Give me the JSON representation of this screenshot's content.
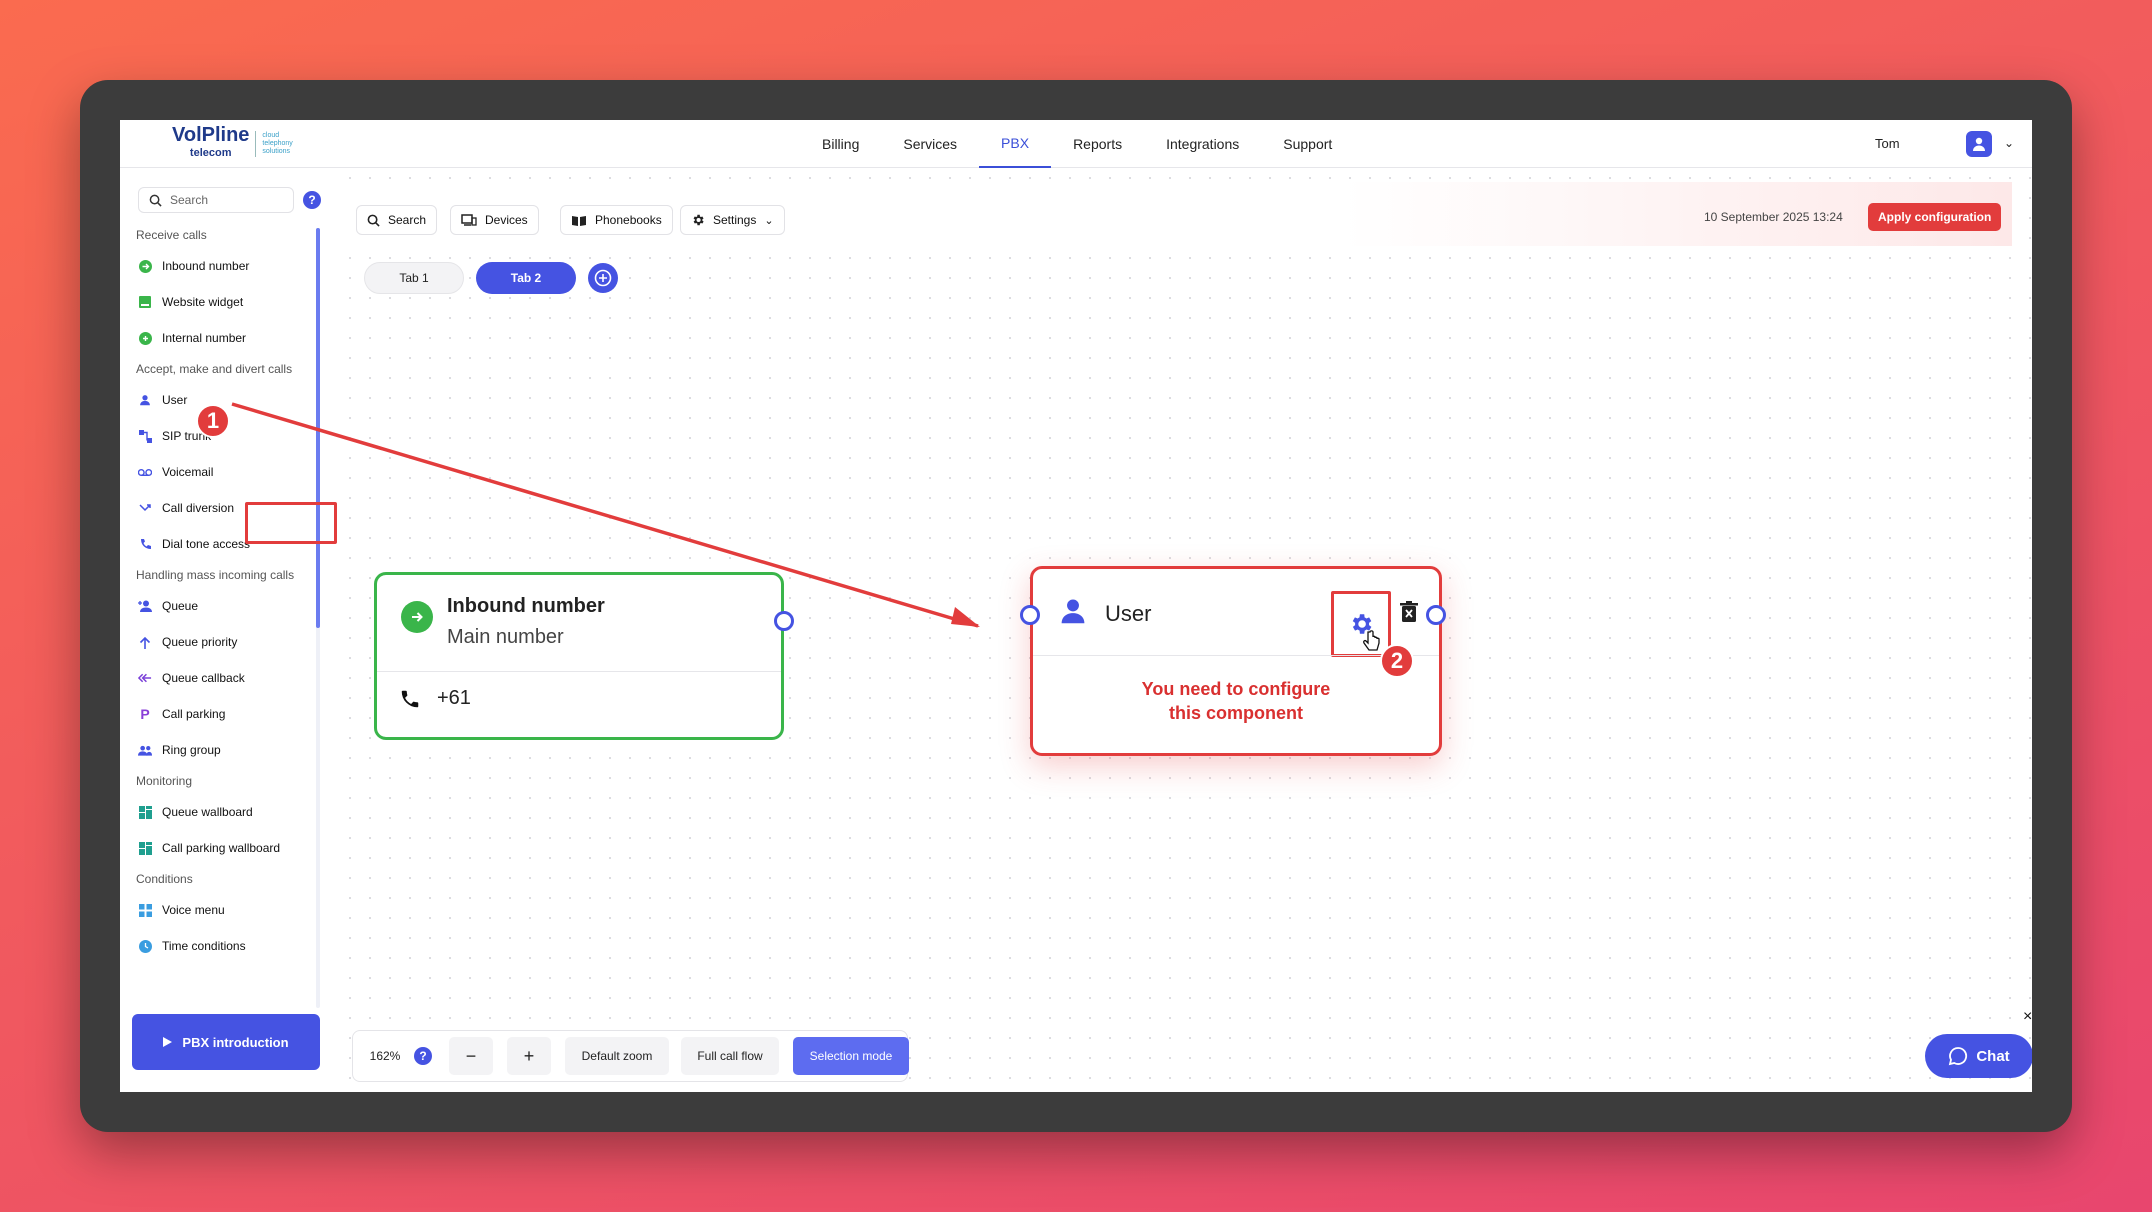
{
  "app": {
    "logo": {
      "brand": "VolPline",
      "sub": "telecom",
      "tagline_lines": [
        "cloud",
        "telephony",
        "solutions"
      ]
    },
    "nav": [
      "Billing",
      "Services",
      "PBX",
      "Reports",
      "Integrations",
      "Support"
    ],
    "active_nav": "PBX",
    "user": {
      "name": "Tom"
    }
  },
  "sidebar": {
    "search_placeholder": "Search",
    "help": "?",
    "sections": [
      {
        "title": "Receive calls",
        "items": [
          {
            "label": "Inbound number",
            "icon": "green-circle-arrow-icon"
          },
          {
            "label": "Website widget",
            "icon": "widget-icon"
          },
          {
            "label": "Internal number",
            "icon": "green-circle-icon"
          }
        ]
      },
      {
        "title": "Accept, make and divert calls",
        "items": [
          {
            "label": "User",
            "icon": "user-icon"
          },
          {
            "label": "SIP trunk",
            "icon": "sip-trunk-icon"
          },
          {
            "label": "Voicemail",
            "icon": "voicemail-icon"
          },
          {
            "label": "Call diversion",
            "icon": "call-diversion-icon"
          },
          {
            "label": "Dial tone access",
            "icon": "dial-tone-icon"
          }
        ]
      },
      {
        "title": "Handling mass incoming calls",
        "items": [
          {
            "label": "Queue",
            "icon": "queue-icon"
          },
          {
            "label": "Queue priority",
            "icon": "arrow-up-icon"
          },
          {
            "label": "Queue callback",
            "icon": "callback-icon"
          },
          {
            "label": "Call parking",
            "icon": "parking-icon"
          },
          {
            "label": "Ring group",
            "icon": "group-icon"
          }
        ]
      },
      {
        "title": "Monitoring",
        "items": [
          {
            "label": "Queue wallboard",
            "icon": "wallboard-icon"
          },
          {
            "label": "Call parking wallboard",
            "icon": "wallboard-icon"
          }
        ]
      },
      {
        "title": "Conditions",
        "items": [
          {
            "label": "Voice menu",
            "icon": "voice-menu-icon"
          },
          {
            "label": "Time conditions",
            "icon": "clock-icon"
          }
        ]
      }
    ],
    "intro_button": "PBX introduction"
  },
  "toolbar": {
    "search": "Search",
    "devices": "Devices",
    "phonebooks": "Phonebooks",
    "settings": "Settings",
    "datetime": "10 September 2025 13:24",
    "apply": "Apply configuration"
  },
  "tabs": [
    "Tab 1",
    "Tab 2"
  ],
  "active_tab": "Tab 2",
  "nodes": {
    "inbound": {
      "title": "Inbound number",
      "subtitle": "Main number",
      "number": "+61"
    },
    "user": {
      "title": "User",
      "message_lines": [
        "You need to configure",
        "this component"
      ]
    }
  },
  "annotations": {
    "step1": "1",
    "step2": "2"
  },
  "zoombar": {
    "zoom": "162%",
    "help": "?",
    "minus": "−",
    "plus": "+",
    "default_zoom": "Default zoom",
    "full_flow": "Full call flow",
    "selection_mode": "Selection mode"
  },
  "chat": {
    "label": "Chat",
    "close": "×"
  },
  "colors": {
    "accent": "#4553e2",
    "danger": "#e23c3c",
    "success": "#3ab54a"
  }
}
